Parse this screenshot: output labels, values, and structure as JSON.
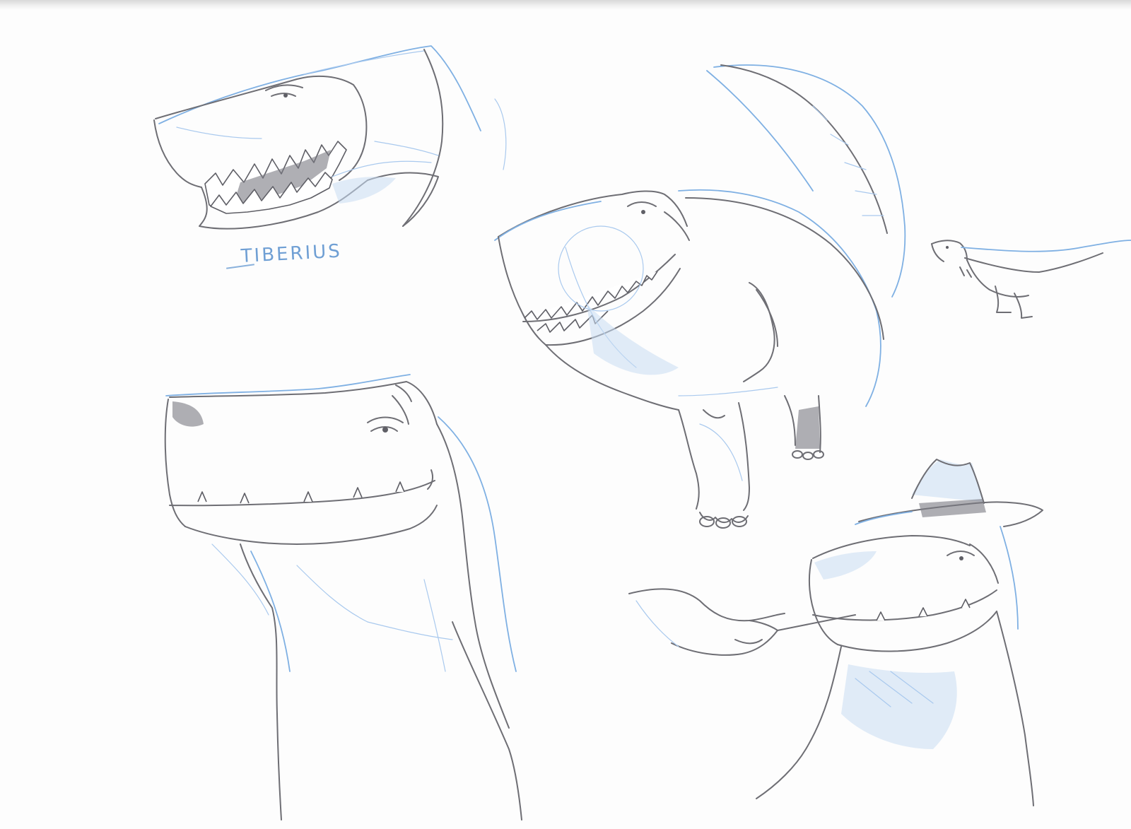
{
  "sheet": {
    "sketch_label": "TIBERIUS",
    "colors": {
      "paper": "#fdfdfd",
      "graphite": "#6e6e74",
      "blue_pencil": "#7fb0e3",
      "blue_shade": "#a9c9ee"
    }
  },
  "sketches": [
    {
      "subject": "snarling-head"
    },
    {
      "subject": "full-body-standing"
    },
    {
      "subject": "small-walking-silhouette"
    },
    {
      "subject": "large-head-and-neck-closeup"
    },
    {
      "subject": "head-with-hat-and-hand"
    }
  ]
}
